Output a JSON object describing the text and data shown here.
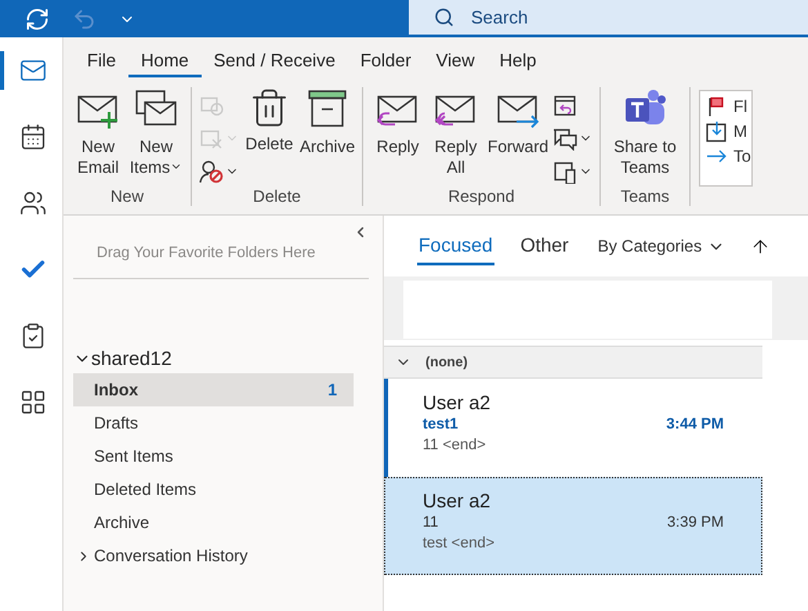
{
  "title_bar": {
    "search_placeholder": "Search"
  },
  "nav_rail": [
    {
      "kind": "mail",
      "selected": true
    },
    {
      "kind": "calendar",
      "selected": false
    },
    {
      "kind": "people",
      "selected": false
    },
    {
      "kind": "todo",
      "selected": false
    },
    {
      "kind": "tasks",
      "selected": false
    },
    {
      "kind": "apps",
      "selected": false
    }
  ],
  "ribbon_tabs": [
    {
      "label": "File",
      "selected": false
    },
    {
      "label": "Home",
      "selected": true
    },
    {
      "label": "Send / Receive",
      "selected": false
    },
    {
      "label": "Folder",
      "selected": false
    },
    {
      "label": "View",
      "selected": false
    },
    {
      "label": "Help",
      "selected": false
    }
  ],
  "ribbon_groups": [
    {
      "label": "New",
      "buttons": [
        {
          "kind": "new-email",
          "label": "New Email",
          "dropdown": false
        },
        {
          "kind": "new-items",
          "label": "New Items",
          "dropdown": true
        }
      ]
    },
    {
      "label": "Delete",
      "small": [
        {
          "kind": "ignore",
          "disabled": true,
          "dropdown": false
        },
        {
          "kind": "cleanup",
          "disabled": true,
          "dropdown": true
        },
        {
          "kind": "junk",
          "disabled": false,
          "dropdown": true
        }
      ],
      "buttons": [
        {
          "kind": "delete",
          "label": "Delete",
          "dropdown": false
        },
        {
          "kind": "archive",
          "label": "Archive",
          "dropdown": false
        }
      ]
    },
    {
      "label": "Respond",
      "buttons": [
        {
          "kind": "reply",
          "label": "Reply",
          "dropdown": false
        },
        {
          "kind": "reply-all",
          "label": "Reply All",
          "dropdown": false
        },
        {
          "kind": "forward",
          "label": "Forward",
          "dropdown": false
        }
      ],
      "small": [
        {
          "kind": "meeting",
          "disabled": false,
          "dropdown": false
        },
        {
          "kind": "im",
          "disabled": false,
          "dropdown": true
        },
        {
          "kind": "more",
          "disabled": false,
          "dropdown": true
        }
      ]
    },
    {
      "label": "Teams",
      "buttons": [
        {
          "kind": "teams",
          "label": "Share to Teams",
          "dropdown": false
        }
      ]
    }
  ],
  "quick_steps": [
    {
      "kind": "flag",
      "label": "Fl"
    },
    {
      "kind": "move",
      "label": "M"
    },
    {
      "kind": "to",
      "label": "To"
    }
  ],
  "folder_pane": {
    "favorites_hint": "Drag Your Favorite Folders Here",
    "account": "shared12",
    "expanded": true,
    "folders": [
      {
        "name": "Inbox",
        "count": "1",
        "selected": true,
        "has_children": false
      },
      {
        "name": "Drafts",
        "selected": false,
        "has_children": false
      },
      {
        "name": "Sent Items",
        "selected": false,
        "has_children": false
      },
      {
        "name": "Deleted Items",
        "selected": false,
        "has_children": false
      },
      {
        "name": "Archive",
        "selected": false,
        "has_children": false
      },
      {
        "name": "Conversation History",
        "selected": false,
        "has_children": true
      }
    ]
  },
  "message_list": {
    "tabs": [
      {
        "label": "Focused",
        "selected": true
      },
      {
        "label": "Other",
        "selected": false
      }
    ],
    "sort": "By Categories",
    "group": {
      "label": "(none)",
      "expanded": true
    },
    "messages": [
      {
        "sender": "User a2",
        "subject": "test1",
        "time": "3:44 PM",
        "preview": "11 <end>",
        "unread": true,
        "selected": false
      },
      {
        "sender": "User a2",
        "subject": "11",
        "time": "3:39 PM",
        "preview": "test <end>",
        "unread": false,
        "selected": true
      }
    ]
  }
}
